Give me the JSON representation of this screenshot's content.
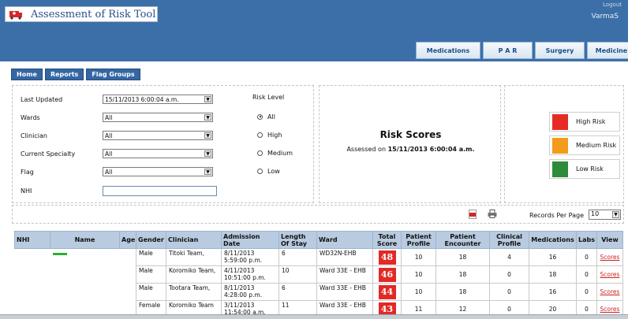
{
  "app": {
    "title": "Assessment of Risk Tool",
    "user": "VarmaS",
    "corner": "Logout"
  },
  "category_tabs": [
    "Medications",
    "P A R",
    "Surgery",
    "Medicine"
  ],
  "nav": [
    "Home",
    "Reports",
    "Flag Groups"
  ],
  "filters": {
    "last_updated": {
      "label": "Last Updated",
      "value": "15/11/2013 6:00:04 a.m."
    },
    "wards": {
      "label": "Wards",
      "value": "All"
    },
    "clinician": {
      "label": "Clinician",
      "value": "All"
    },
    "specialty": {
      "label": "Current Specialty",
      "value": "All"
    },
    "flag": {
      "label": "Flag",
      "value": "All"
    },
    "nhi": {
      "label": "NHI",
      "value": ""
    }
  },
  "risk_level": {
    "label": "Risk Level",
    "options": [
      "All",
      "High",
      "Medium",
      "Low"
    ],
    "selected": "All"
  },
  "scores": {
    "title": "Risk Scores",
    "assessed_prefix": "Assessed on",
    "assessed_value": "15/11/2013 6:00:04 a.m."
  },
  "legend": [
    {
      "label": "High Risk",
      "color": "#e62b25"
    },
    {
      "label": "Medium Risk",
      "color": "#f39b1c"
    },
    {
      "label": "Low Risk",
      "color": "#2e8b3a"
    }
  ],
  "records": {
    "label": "Records Per Page",
    "value": "10"
  },
  "table": {
    "headers": [
      "NHI",
      "Name",
      "Age",
      "Gender",
      "Clinician",
      "Admission Date",
      "Length Of Stay",
      "Ward",
      "Total Score",
      "Patient Profile",
      "Patient Encounter",
      "Clinical Profile",
      "Medications",
      "Labs",
      "View"
    ],
    "rows": [
      {
        "gender": "Male",
        "clinician": "Titoki Team,",
        "admission": "8/11/2013 5:59:00 p.m.",
        "los": "6",
        "ward": "WD32N-EHB",
        "score": "48",
        "pp": "10",
        "pe": "18",
        "cp": "4",
        "med": "16",
        "labs": "0",
        "view": "Scores"
      },
      {
        "gender": "Male",
        "clinician": "Koromiko Team,",
        "admission": "4/11/2013 10:51:00 p.m.",
        "los": "10",
        "ward": "Ward 33E - EHB",
        "score": "46",
        "pp": "10",
        "pe": "18",
        "cp": "0",
        "med": "18",
        "labs": "0",
        "view": "Scores"
      },
      {
        "gender": "Male",
        "clinician": "Tootara Team,",
        "admission": "8/11/2013 4:28:00 p.m.",
        "los": "6",
        "ward": "Ward 33E - EHB",
        "score": "44",
        "pp": "10",
        "pe": "18",
        "cp": "0",
        "med": "16",
        "labs": "0",
        "view": "Scores"
      },
      {
        "gender": "Female",
        "clinician": "Koromiko Team",
        "admission": "3/11/2013 11:54:00 a.m.",
        "los": "11",
        "ward": "Ward 33E - EHB",
        "score": "43",
        "pp": "11",
        "pe": "12",
        "cp": "0",
        "med": "20",
        "labs": "0",
        "view": "Scores"
      }
    ]
  }
}
